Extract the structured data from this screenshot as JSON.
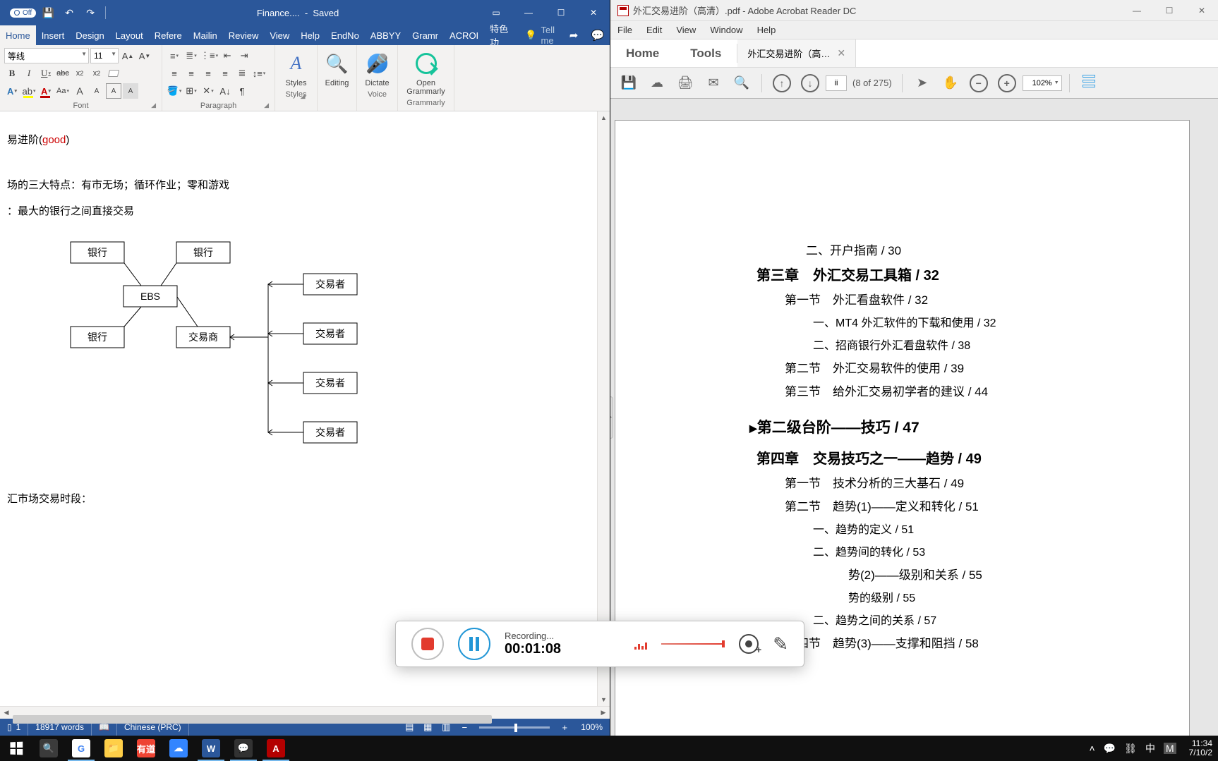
{
  "word": {
    "titlebar": {
      "filename": "Finance....",
      "state": "Saved",
      "autosave": "Off"
    },
    "tabs": [
      "Home",
      "Insert",
      "Design",
      "Layout",
      "Refere",
      "Mailin",
      "Review",
      "View",
      "Help",
      "EndNo",
      "ABBYY",
      "Gramr",
      "ACROI",
      "特色功"
    ],
    "tell_me": "Tell me",
    "font": {
      "name": "等线",
      "size": "11",
      "group_label": "Font"
    },
    "paragraph": {
      "group_label": "Paragraph"
    },
    "styles": {
      "group_label": "Styles",
      "caption": "Styles"
    },
    "editing": {
      "group_label": "Editing",
      "caption": "Editing"
    },
    "voice": {
      "group_label": "Voice",
      "caption": "Dictate"
    },
    "grammarly": {
      "group_label": "Grammarly",
      "caption": "Open Grammarly"
    },
    "body": {
      "line1_pre": "易进阶(",
      "line1_good": "good",
      "line1_post": ")",
      "line2": "场的三大特点：有市无场；循环作业；零和游戏",
      "line3": "：最大的银行之间直接交易",
      "line4": "汇市场交易时段：",
      "diagram": {
        "bank1": "银行",
        "bank2": "银行",
        "bank3": "银行",
        "ebs": "EBS",
        "dealer": "交易商",
        "trader1": "交易者",
        "trader2": "交易者",
        "trader3": "交易者",
        "trader4": "交易者"
      }
    },
    "status": {
      "sec": "1",
      "words": "18917 words",
      "lang": "Chinese (PRC)",
      "zoom": "100%"
    }
  },
  "acrobat": {
    "title": "外汇交易进阶（高清）.pdf - Adobe Acrobat Reader DC",
    "menus": [
      "File",
      "Edit",
      "View",
      "Window",
      "Help"
    ],
    "tabs": {
      "home": "Home",
      "tools": "Tools",
      "doc": "外汇交易进阶（高…"
    },
    "toolbar": {
      "page_input": "ii",
      "page_label": "(8 of 275)",
      "zoom": "102%"
    },
    "toc": {
      "l1": "二、开户指南 / 30",
      "ch3": "第三章　外汇交易工具箱 / 32",
      "s31": "第一节　外汇看盘软件 / 32",
      "s31a": "一、MT4 外汇软件的下载和使用 / 32",
      "s31b": "二、招商银行外汇看盘软件 / 38",
      "s32": "第二节　外汇交易软件的使用 / 39",
      "s33": "第三节　给外汇交易初学者的建议 / 44",
      "stage2": "第二级台阶——技巧 / 47",
      "ch4": "第四章　交易技巧之一——趋势 / 49",
      "s41": "第一节　技术分析的三大基石 / 49",
      "s42": "第二节　趋势(1)——定义和转化 / 51",
      "s42a": "一、趋势的定义 / 51",
      "s42b": "二、趋势间的转化 / 53",
      "s43p": "势(2)——级别和关系 / 55",
      "s43pa": "势的级别 / 55",
      "s43b": "二、趋势之间的关系 / 57",
      "s44": "第四节　趋势(3)——支撑和阻挡 / 58"
    }
  },
  "recorder": {
    "state": "Recording...",
    "time": "00:01:08"
  },
  "taskbar": {
    "tray_lang": "中",
    "clock_time": "11:34",
    "clock_date": "7/10/2"
  }
}
